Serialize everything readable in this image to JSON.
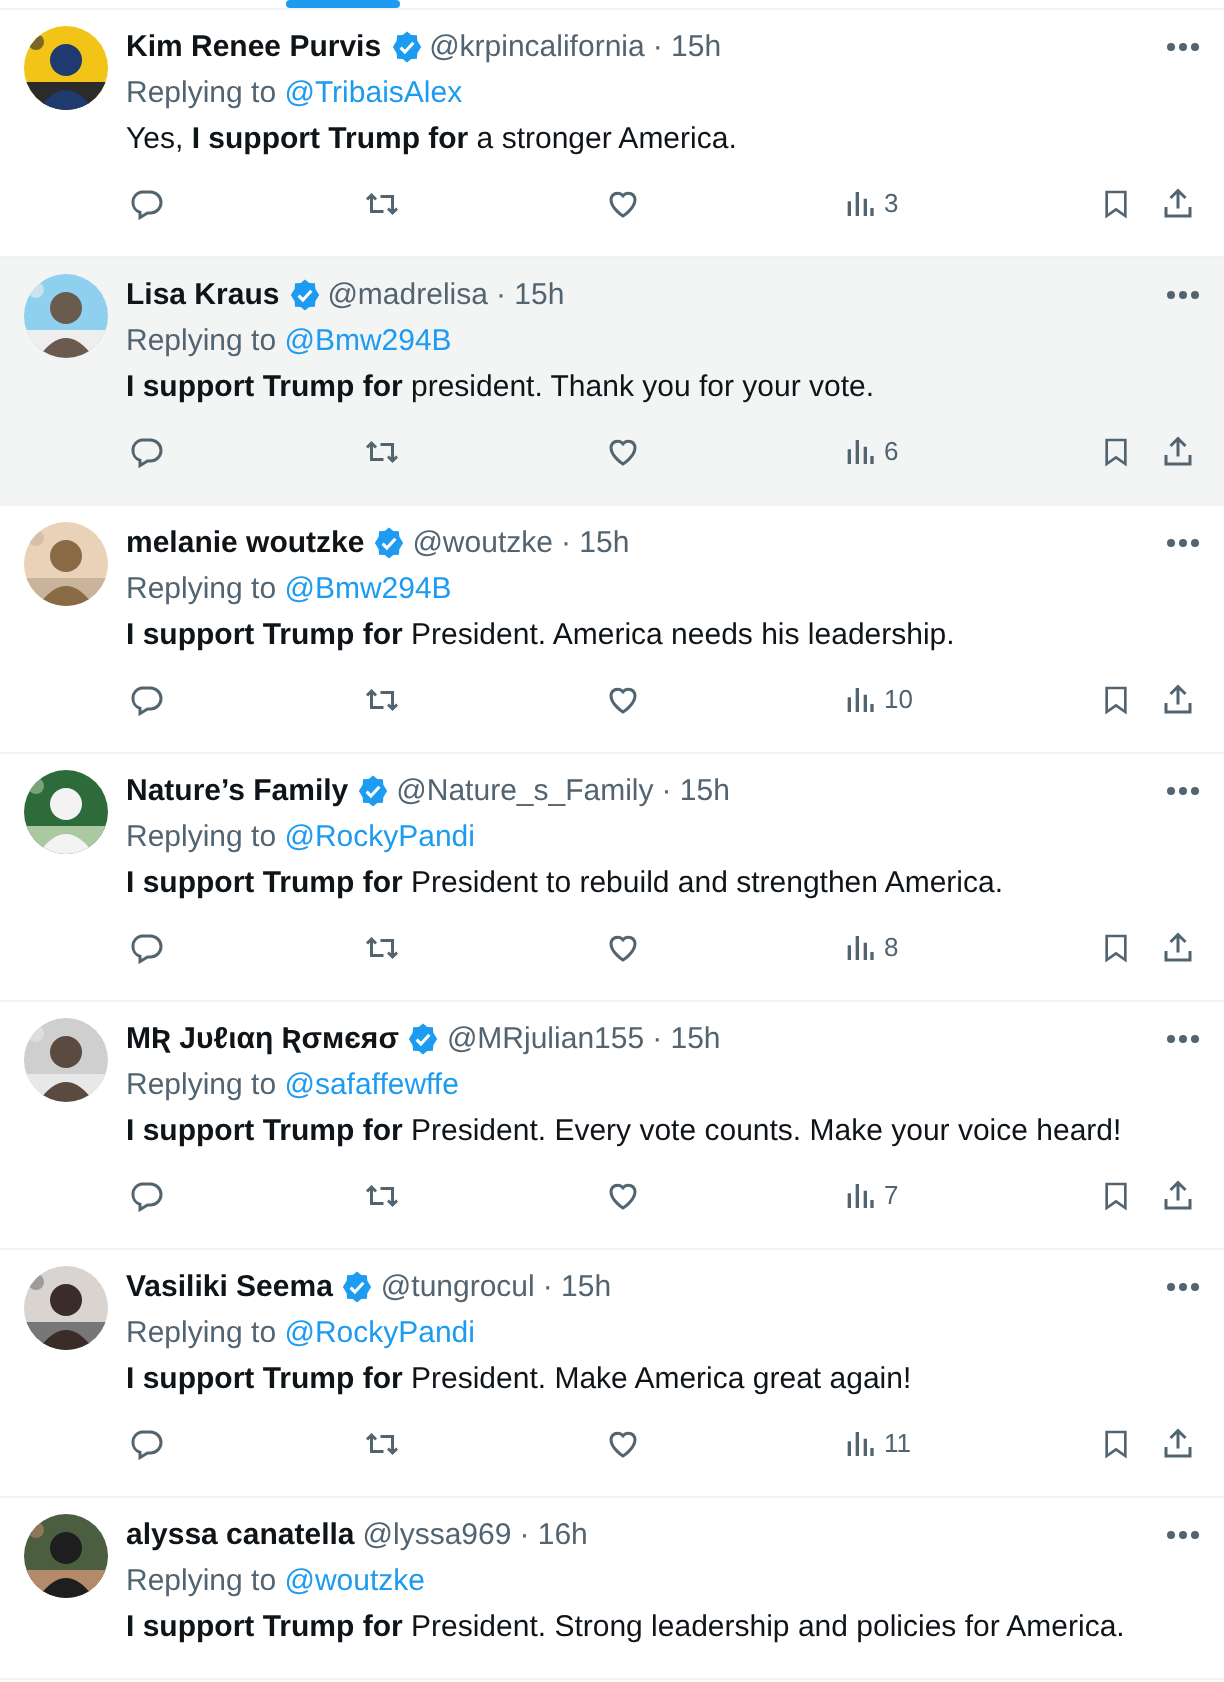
{
  "replies": [
    {
      "name": "Kim Renee Purvis",
      "verified": true,
      "handle": "@krpincalifornia",
      "time": "· 15h",
      "replying_label": "Replying to",
      "replying_to": "@TribaisAlex",
      "text": "Yes, **I support Trump for** a stronger America.",
      "views": "3",
      "highlighted": false
    },
    {
      "name": "Lisa Kraus",
      "verified": true,
      "handle": "@madrelisa",
      "time": "· 15h",
      "replying_label": "Replying to",
      "replying_to": "@Bmw294B",
      "text": "**I support Trump for** president. Thank you for your vote.",
      "views": "6",
      "highlighted": true
    },
    {
      "name": "melanie woutzke",
      "verified": true,
      "handle": "@woutzke",
      "time": "· 15h",
      "replying_label": "Replying to",
      "replying_to": "@Bmw294B",
      "text": "**I support Trump for** President. America needs his leadership.",
      "views": "10",
      "highlighted": false
    },
    {
      "name": "Nature’s Family",
      "verified": true,
      "handle": "@Nature_s_Family",
      "time": "· 15h",
      "replying_label": "Replying to",
      "replying_to": "@RockyPandi",
      "text": "**I support Trump for** President to rebuild and strengthen America.",
      "views": "8",
      "highlighted": false
    },
    {
      "name": "MƦ Jυℓιαη Ʀσмєяσ",
      "verified": true,
      "handle": "@MRjulian155",
      "time": "· 15h",
      "replying_label": "Replying to",
      "replying_to": "@safaffewffe",
      "text": "**I support Trump for** President. Every vote counts. Make your voice heard!",
      "views": "7",
      "highlighted": false
    },
    {
      "name": "Vasiliki Seema",
      "verified": true,
      "handle": "@tungrocul",
      "time": "· 15h",
      "replying_label": "Replying to",
      "replying_to": "@RockyPandi",
      "text": "**I support Trump for** President. Make America great again!",
      "views": "11",
      "highlighted": false
    },
    {
      "name": "alyssa canatella",
      "verified": false,
      "handle": "@lyssa969",
      "time": "· 16h",
      "replying_label": "Replying to",
      "replying_to": "@woutzke",
      "text": "**I support Trump for** President. Strong leadership and policies for America.",
      "highlighted": false
    }
  ]
}
